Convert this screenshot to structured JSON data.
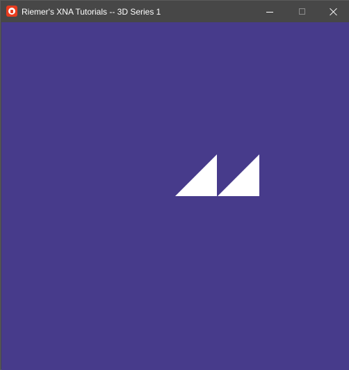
{
  "window": {
    "title": "Riemer's XNA Tutorials -- 3D Series 1",
    "icon": "monogame-icon"
  },
  "title_bar": {
    "controls": [
      {
        "name": "minimize",
        "icon": "minimize-icon"
      },
      {
        "name": "maximize",
        "icon": "maximize-icon",
        "enabled": false
      },
      {
        "name": "close",
        "icon": "close-icon"
      }
    ]
  },
  "viewport": {
    "background_color": "#473b8b",
    "shape_color": "#ffffff",
    "content": "two-white-triangles"
  }
}
